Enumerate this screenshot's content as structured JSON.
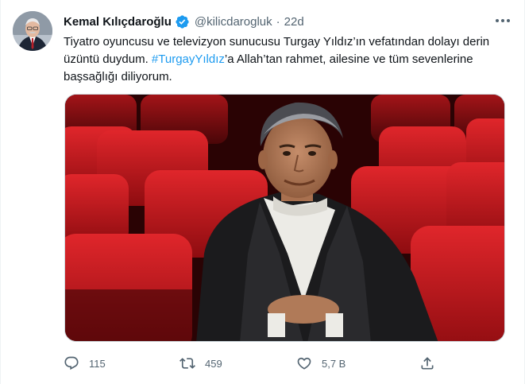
{
  "author": {
    "display_name": "Kemal Kılıçdaroğlu",
    "handle": "@kilicdarogluk",
    "separator": "·",
    "time": "22d",
    "verified": true
  },
  "tweet": {
    "text_before": "Tiyatro oyuncusu ve televizyon sunucusu Turgay Yıldız’ın vefatından dolayı derin üzüntü duydum. ",
    "hashtag": "#TurgayYıldız",
    "text_after": "’a Allah’tan rahmet, ailesine ve tüm sevenlerine başsağlığı diliyorum."
  },
  "actions": {
    "reply_count": "115",
    "retweet_count": "459",
    "like_count": "5,7 B"
  },
  "colors": {
    "link": "#1d9bf0",
    "muted": "#536471",
    "text": "#0f1419",
    "seat_red": "#c8141a"
  },
  "icons": [
    "verified-badge-icon",
    "more-icon",
    "reply-icon",
    "retweet-icon",
    "like-icon",
    "share-icon"
  ]
}
